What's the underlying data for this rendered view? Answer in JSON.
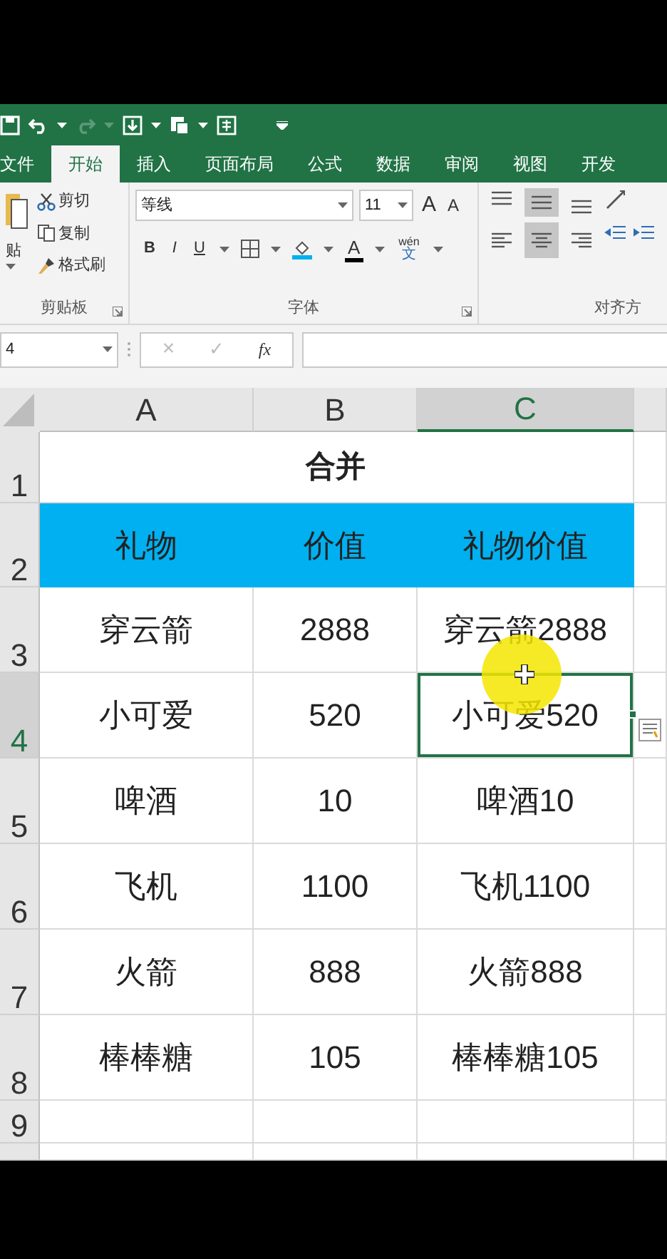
{
  "quick_access": [
    {
      "kind": "save"
    },
    {
      "kind": "undo",
      "disabled": false
    },
    {
      "kind": "redo",
      "disabled": true
    },
    {
      "kind": "form"
    },
    {
      "kind": "preview"
    },
    {
      "kind": "sheet"
    },
    {
      "kind": "customize"
    }
  ],
  "tabs": [
    {
      "label": "文件",
      "selected": false
    },
    {
      "label": "开始",
      "selected": true
    },
    {
      "label": "插入",
      "selected": false
    },
    {
      "label": "页面布局",
      "selected": false
    },
    {
      "label": "公式",
      "selected": false
    },
    {
      "label": "数据",
      "selected": false
    },
    {
      "label": "审阅",
      "selected": false
    },
    {
      "label": "视图",
      "selected": false
    },
    {
      "label": "开发",
      "selected": false
    }
  ],
  "ribbon": {
    "clipboard": {
      "paste": "贴",
      "cut": "剪切",
      "copy": "复制",
      "painter": "格式刷",
      "label": "剪贴板"
    },
    "font": {
      "name": "等线",
      "size": "11",
      "grow": "A",
      "shrink": "A",
      "bold": "B",
      "italic": "I",
      "underline": "U",
      "font_color": "A",
      "phonetic_top": "wén",
      "phonetic": "文",
      "label": "字体"
    },
    "alignment": {
      "buttons": [
        {
          "kind": "top",
          "selected": false
        },
        {
          "kind": "middle",
          "selected": true
        },
        {
          "kind": "bottom",
          "selected": false
        },
        {
          "kind": "left",
          "selected": false
        },
        {
          "kind": "center",
          "selected": true
        },
        {
          "kind": "right",
          "selected": false
        }
      ],
      "label": "对齐方"
    }
  },
  "formula_bar": {
    "name_box": "4",
    "cancel": "×",
    "enter": "✓",
    "fx": "fx"
  },
  "sheet": {
    "columns": [
      {
        "label": "A",
        "selected": false
      },
      {
        "label": "B",
        "selected": false
      },
      {
        "label": "C",
        "selected": true
      }
    ],
    "rows": [
      {
        "number": "1",
        "kind": "merged",
        "selected": false,
        "cells": [
          "",
          "合并",
          ""
        ]
      },
      {
        "number": "2",
        "kind": "header",
        "selected": false,
        "cells": [
          "礼物",
          "价值",
          "礼物价值"
        ]
      },
      {
        "number": "3",
        "kind": "data",
        "selected": false,
        "cells": [
          "穿云箭",
          "2888",
          "穿云箭2888"
        ]
      },
      {
        "number": "4",
        "kind": "data",
        "selected": true,
        "cells": [
          "小可爱",
          "520",
          "小可爱520"
        ]
      },
      {
        "number": "5",
        "kind": "data",
        "selected": false,
        "cells": [
          "啤酒",
          "10",
          "啤酒10"
        ]
      },
      {
        "number": "6",
        "kind": "data",
        "selected": false,
        "cells": [
          "飞机",
          "1100",
          "飞机1100"
        ]
      },
      {
        "number": "7",
        "kind": "data",
        "selected": false,
        "cells": [
          "火箭",
          "888",
          "火箭888"
        ]
      },
      {
        "number": "8",
        "kind": "data",
        "selected": false,
        "cells": [
          "棒棒糖",
          "105",
          "棒棒糖105"
        ]
      },
      {
        "number": "9",
        "kind": "empty",
        "selected": false,
        "cells": []
      }
    ]
  }
}
